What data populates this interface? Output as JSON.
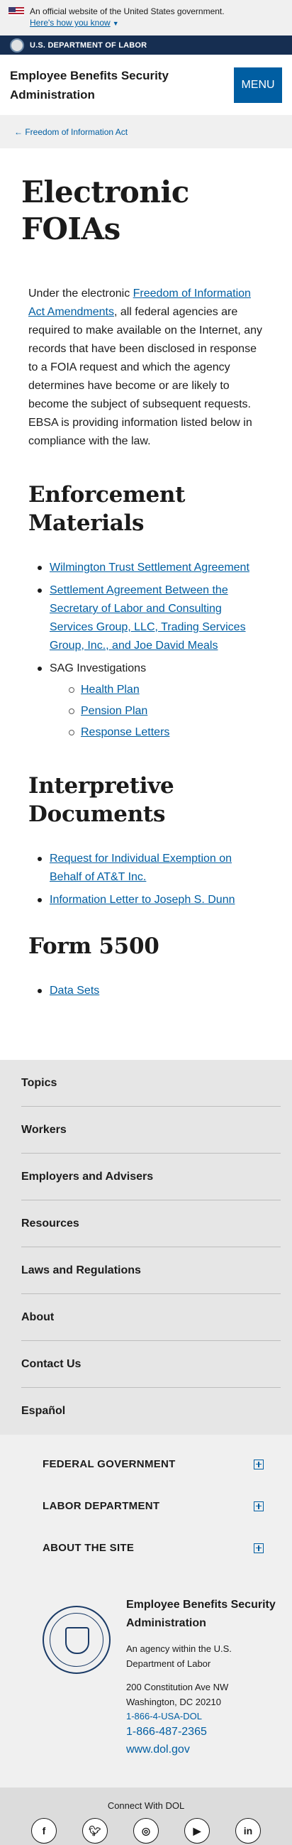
{
  "gov_banner": {
    "official_text": "An official website of the United States government.",
    "how_link": "Here's how you know"
  },
  "dept_bar": {
    "label": "U.S. DEPARTMENT OF LABOR"
  },
  "header": {
    "site_title": "Employee Benefits Security Administration",
    "menu_label": "MENU"
  },
  "breadcrumb": {
    "back_link": "Freedom of Information Act"
  },
  "main": {
    "title": "Electronic FOIAs",
    "intro_before": "Under the electronic ",
    "intro_link": "Freedom of Information Act Amendments",
    "intro_after": ", all federal agencies are required to make available on the Internet, any records that have been disclosed in response to a FOIA request and which the agency determines have become or are likely to become the subject of subsequent requests. EBSA is providing information listed below in compliance with the law.",
    "enforcement": {
      "heading": "Enforcement Materials",
      "items": [
        "Wilmington Trust Settlement Agreement",
        "Settlement Agreement Between the Secretary of Labor and Consulting Services Group, LLC, Trading Services Group, Inc., and Joe David Meals"
      ],
      "sag_label": "SAG Investigations",
      "sag_items": [
        "Health Plan",
        "Pension Plan",
        "Response Letters"
      ]
    },
    "interpretive": {
      "heading": "Interpretive Documents",
      "items": [
        "Request for Individual Exemption on Behalf of AT&T Inc.",
        "Information Letter to Joseph S. Dunn"
      ]
    },
    "form5500": {
      "heading": "Form 5500",
      "items": [
        "Data Sets"
      ]
    }
  },
  "footer_nav": [
    "Topics",
    "Workers",
    "Employers and Advisers",
    "Resources",
    "Laws and Regulations",
    "About",
    "Contact Us",
    "Español"
  ],
  "accordions": [
    "FEDERAL GOVERNMENT",
    "LABOR DEPARTMENT",
    "ABOUT THE SITE"
  ],
  "agency": {
    "name": "Employee Benefits Security Administration",
    "subtitle": "An agency within the U.S. Department of Labor",
    "address_line1": "200 Constitution Ave NW",
    "address_line2": "Washington, DC 20210",
    "phone1": "1-866-4-USA-DOL",
    "phone2": "1-866-487-2365",
    "website": "www.dol.gov"
  },
  "social": {
    "title": "Connect With DOL",
    "icons": [
      "facebook-icon",
      "twitter-icon",
      "instagram-icon",
      "youtube-icon",
      "linkedin-icon"
    ]
  },
  "colors": {
    "link": "#005ea2",
    "dept_bar": "#162e51",
    "menu_button": "#005ea2",
    "banner_bg": "#f0f0f0",
    "footer_nav_bg": "#e6e6e6"
  }
}
